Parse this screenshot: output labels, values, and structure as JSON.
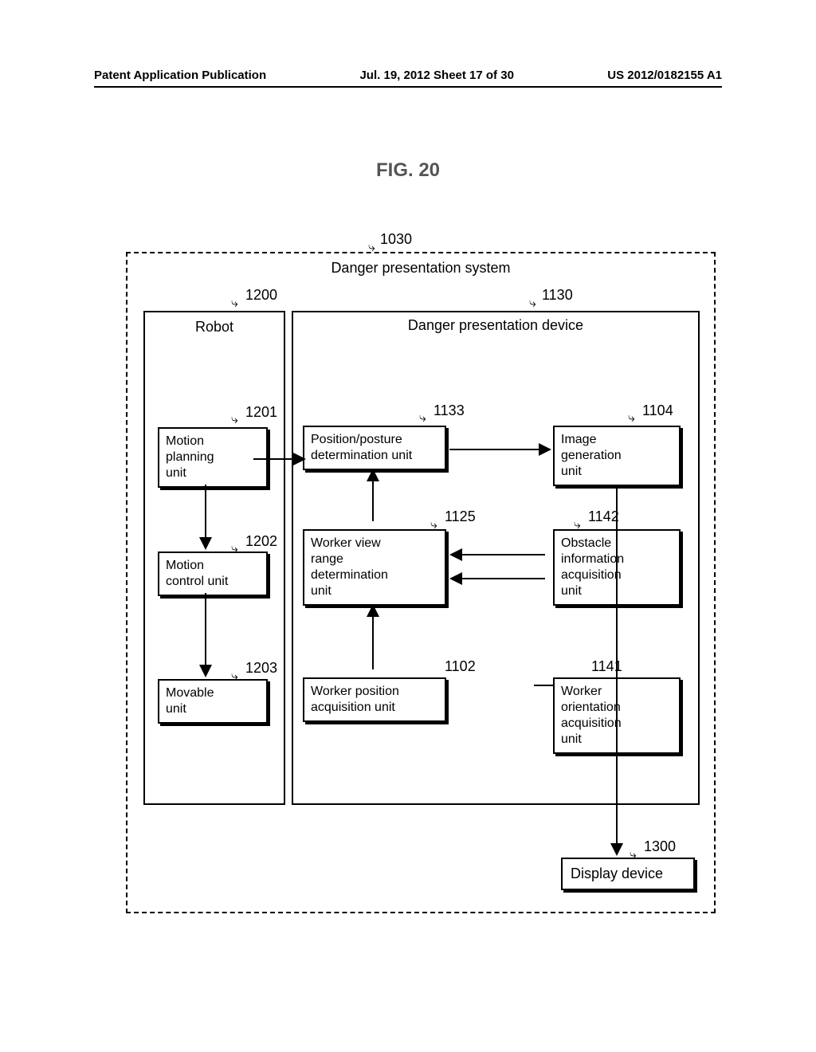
{
  "header": {
    "left": "Patent Application Publication",
    "center": "Jul. 19, 2012  Sheet 17 of 30",
    "right": "US 2012/0182155 A1"
  },
  "figure_title": "FIG. 20",
  "system": {
    "ref": "1030",
    "title": "Danger presentation system"
  },
  "robot": {
    "ref": "1200",
    "title": "Robot",
    "units": {
      "motion_planning": {
        "ref": "1201",
        "label": "Motion\nplanning\nunit"
      },
      "motion_control": {
        "ref": "1202",
        "label": "Motion\ncontrol unit"
      },
      "movable": {
        "ref": "1203",
        "label": "Movable\nunit"
      }
    }
  },
  "device": {
    "ref": "1130",
    "title": "Danger presentation device",
    "units": {
      "pos_posture": {
        "ref": "1133",
        "label": "Position/posture\ndetermination unit"
      },
      "image_gen": {
        "ref": "1104",
        "label": "Image\ngeneration\nunit"
      },
      "view_range": {
        "ref": "1125",
        "label": "Worker view\nrange\ndetermination\nunit"
      },
      "obstacle_info": {
        "ref": "1142",
        "label": "Obstacle\ninformation\nacquisition\nunit"
      },
      "worker_pos": {
        "ref": "1102",
        "label": "Worker position\nacquisition unit"
      },
      "worker_orient": {
        "ref": "1141",
        "label": "Worker\norientation\nacquisition\nunit"
      }
    }
  },
  "display": {
    "ref": "1300",
    "label": "Display device"
  }
}
